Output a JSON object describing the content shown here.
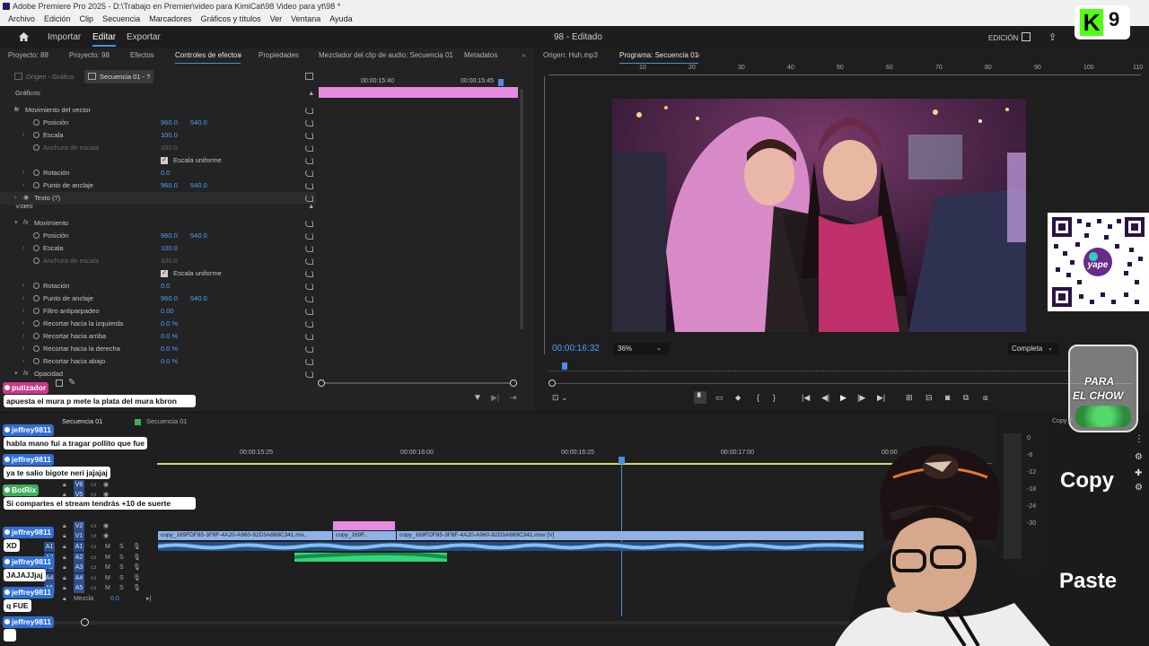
{
  "window": {
    "title": "Adobe Premiere Pro 2025 - D:\\Trabajo en Premier\\video para KimiCat\\98 Video para yt\\98 *"
  },
  "menu": [
    "Archivo",
    "Edición",
    "Clip",
    "Secuencia",
    "Marcadores",
    "Gráficos y títulos",
    "Ver",
    "Ventana",
    "Ayuda"
  ],
  "header": {
    "nav": [
      "Importar",
      "Editar",
      "Exportar"
    ],
    "project_status": "98 - Editado",
    "workspace": "EDICIÓN"
  },
  "left_tabs": [
    "Proyecto: 88",
    "Proyecto: 98",
    "Efectos",
    "Controles de efectos",
    "Propiedades",
    "Mezclador del clip de audio: Secuencia 01",
    "Metadatos"
  ],
  "effect_controls": {
    "source_tab": "Origen - Gráfico",
    "seq_tab": "Secuencia 01 - ?",
    "tc1": "00:00:15:40",
    "tc2": "00:00:15:45",
    "section_graphics": "Gráficos",
    "section_video": "Vídeo",
    "rows": [
      {
        "label": "Movimiento del vector",
        "v1": "",
        "v2": ""
      },
      {
        "label": "Posición",
        "v1": "960.0",
        "v2": "540.0"
      },
      {
        "label": "Escala",
        "v1": "100.0",
        "v2": ""
      },
      {
        "label": "Anchura de escala",
        "v1": "100.0",
        "v2": ""
      },
      {
        "label": "Escala uniforme",
        "v1": "",
        "v2": ""
      },
      {
        "label": "Rotación",
        "v1": "0.0",
        "v2": ""
      },
      {
        "label": "Punto de anclaje",
        "v1": "960.0",
        "v2": "540.0"
      },
      {
        "label": "Texto (?)",
        "v1": "",
        "v2": ""
      },
      {
        "label": "Movimiento",
        "v1": "",
        "v2": ""
      },
      {
        "label": "Posición",
        "v1": "960.0",
        "v2": "540.0"
      },
      {
        "label": "Escala",
        "v1": "100.0",
        "v2": ""
      },
      {
        "label": "Anchura de escala",
        "v1": "100.0",
        "v2": ""
      },
      {
        "label": "Escala uniforme",
        "v1": "",
        "v2": ""
      },
      {
        "label": "Rotación",
        "v1": "0.0",
        "v2": ""
      },
      {
        "label": "Punto de anclaje",
        "v1": "960.0",
        "v2": "540.0"
      },
      {
        "label": "Filtro antiparpadeo",
        "v1": "0.00",
        "v2": ""
      },
      {
        "label": "Recortar hacia la izquierda",
        "v1": "0.0 %",
        "v2": ""
      },
      {
        "label": "Recortar hacia arriba",
        "v1": "0.0 %",
        "v2": ""
      },
      {
        "label": "Recortar hacia la derecha",
        "v1": "0.0 %",
        "v2": ""
      },
      {
        "label": "Recortar hacia abajo",
        "v1": "0.0 %",
        "v2": ""
      },
      {
        "label": "Opacidad",
        "v1": "",
        "v2": ""
      }
    ]
  },
  "program": {
    "source_tab": "Origen: Huh.mp3",
    "program_tab": "Programa: Secuencia 01",
    "ruler": [
      "10",
      "20",
      "30",
      "40",
      "50",
      "60",
      "70",
      "80",
      "90",
      "100",
      "110",
      "120"
    ],
    "timecode": "00:00:16:32",
    "zoom": "36%",
    "quality": "Completa"
  },
  "timeline": {
    "seq_tabs": [
      "Secuencia 01",
      "Secuencia 01"
    ],
    "ticks": [
      "00:00:15:25",
      "00:00:16:00",
      "00:00:16:25",
      "00:00:17:00",
      "00:00"
    ],
    "video_tracks": [
      "V6",
      "V5",
      "V2",
      "V1"
    ],
    "audio_tracks": [
      "A1",
      "A2",
      "A3",
      "A4",
      "A5"
    ],
    "mix_label": "Mezcla",
    "mix_value": "0.0",
    "clips": [
      "copy_169FDF85-3F8F-4A20-A960-92D3A889C341.mo..",
      "copy_169F..",
      "copy_169FDF85-3F8F-4A20-A960-92D3A889C341.mov [V]"
    ],
    "meter_scale": [
      "0",
      "-6",
      "-12",
      "-18",
      "-24",
      "-30"
    ]
  },
  "chat": [
    {
      "name": "putizador",
      "msg": "apuesta el mura p mete la plata del mura kbron",
      "color": "#c93a8a"
    },
    {
      "name": "jeffrey9811",
      "msg": "habla mano fui a tragar pollito que fue",
      "color": "#2f6fd6"
    },
    {
      "name": "jeffrey9811",
      "msg": "ya te salio bigote neri jajajaj",
      "color": "#2f6fd6"
    },
    {
      "name": "BotRix",
      "msg": "Si compartes el stream tendrás +10 de suerte",
      "color": "#3fae57"
    },
    {
      "name": "jeffrey9811",
      "msg": "XD",
      "color": "#2f6fd6"
    },
    {
      "name": "jeffrey9811",
      "msg": "JAJAJJjaj",
      "color": "#2f6fd6"
    },
    {
      "name": "jeffrey9811",
      "msg": "q FUE",
      "color": "#2f6fd6"
    },
    {
      "name": "jeffrey9811",
      "msg": "",
      "color": "#2f6fd6"
    }
  ],
  "overlay": {
    "kick_number": "9",
    "jar_text_1": "PARA",
    "jar_text_2": "EL CHOW",
    "copy_label": "Copy",
    "paste_label": "Paste",
    "copy_small": "Copy P",
    "qr_brand": "yape"
  },
  "colors": {
    "accent": "#4a8fe0",
    "value": "#4aa0ff",
    "kick": "#53fc18",
    "clip_video": "#8fb3e6",
    "clip_pink": "#e58be0",
    "clip_audio": "#2fd87a"
  }
}
